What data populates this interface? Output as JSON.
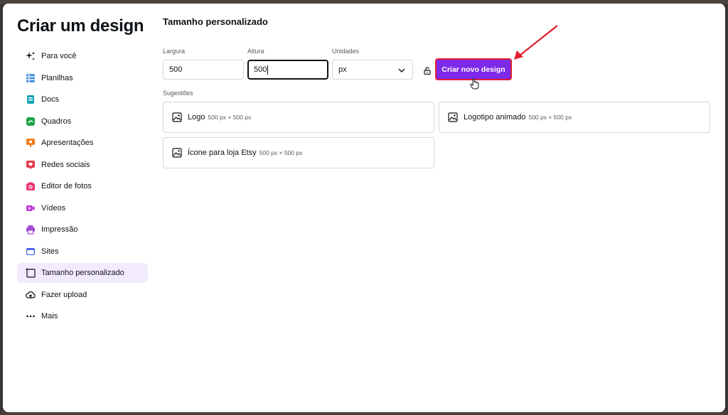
{
  "title": "Criar um design",
  "sidebar": {
    "items": [
      {
        "label": "Para você",
        "icon": "sparkle-icon"
      },
      {
        "label": "Planilhas",
        "icon": "sheet-icon"
      },
      {
        "label": "Docs",
        "icon": "doc-icon"
      },
      {
        "label": "Quadros",
        "icon": "whiteboard-icon"
      },
      {
        "label": "Apresentações",
        "icon": "presentation-icon"
      },
      {
        "label": "Redes sociais",
        "icon": "heart-icon"
      },
      {
        "label": "Editor de fotos",
        "icon": "camera-icon"
      },
      {
        "label": "Vídeos",
        "icon": "video-icon"
      },
      {
        "label": "Impressão",
        "icon": "printer-icon"
      },
      {
        "label": "Sites",
        "icon": "website-icon"
      },
      {
        "label": "Tamanho personalizado",
        "icon": "custom-size-icon"
      },
      {
        "label": "Fazer upload",
        "icon": "upload-icon"
      },
      {
        "label": "Mais",
        "icon": "more-icon"
      }
    ],
    "active_index": 10
  },
  "main": {
    "heading": "Tamanho personalizado",
    "width_label": "Largura",
    "width_value": "500",
    "height_label": "Altura",
    "height_value": "500",
    "units_label": "Unidades",
    "units_value": "px",
    "create_button": "Criar novo design",
    "suggestions_label": "Sugestões",
    "suggestions": [
      {
        "name": "Logo",
        "dims": "500 px × 500 px"
      },
      {
        "name": "Logotipo animado",
        "dims": "500 px × 500 px"
      },
      {
        "name": "Ícone para loja Etsy",
        "dims": "500 px × 500 px"
      }
    ]
  },
  "colors": {
    "accent": "#7d2ae8",
    "highlight_border": "#e01e2e",
    "active_bg": "#f1ebfd"
  }
}
